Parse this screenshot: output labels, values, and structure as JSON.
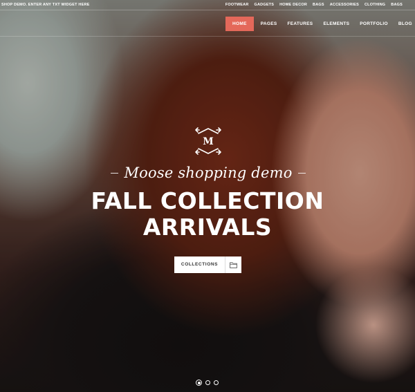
{
  "topbar": {
    "promo": "SHOP DEMO. ENTER ANY TXT WIDGET HERE",
    "categories": [
      "FOOTWEAR",
      "GADGETS",
      "HOME DECOR",
      "BAGS",
      "ACCESSORIES",
      "CLOTHING",
      "BAGS"
    ]
  },
  "nav": {
    "items": [
      "HOME",
      "PAGES",
      "FEATURES",
      "ELEMENTS",
      "PORTFOLIO",
      "BLOG"
    ],
    "active_index": 0,
    "active_color": "#e4685a"
  },
  "hero": {
    "logo_letter": "M",
    "script_title": "Moose shopping demo",
    "headline_line1": "FALL COLLECTION",
    "headline_line2": "ARRIVALS",
    "cta_label": "COLLECTIONS",
    "cta_icon": "folder-icon"
  },
  "slider": {
    "slide_count": 3,
    "active_slide": 1
  }
}
